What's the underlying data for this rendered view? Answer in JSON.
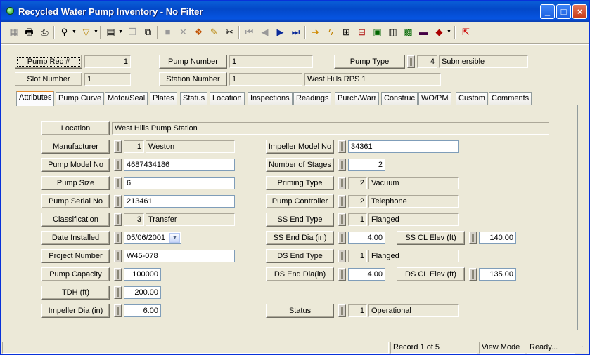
{
  "window": {
    "title": "Recycled Water Pump Inventory - No Filter",
    "minimize_label": "_",
    "maximize_label": "□",
    "close_label": "×"
  },
  "toolbar": {
    "icons": [
      "grid-icon",
      "print-icon",
      "print-preview-icon",
      "binoculars-icon",
      "filter-icon",
      "new-record-icon",
      "copy-icon",
      "paste-icon",
      "save-icon",
      "delete-icon",
      "stack-icon",
      "pencil-icon",
      "scissors-icon",
      "first-record-icon",
      "previous-record-icon",
      "next-record-icon",
      "last-record-icon",
      "jump-icon",
      "lightning-icon",
      "link-icon",
      "tree-icon",
      "map-icon",
      "calculator-icon",
      "chart-icon",
      "books-icon",
      "exit-icon"
    ]
  },
  "header": {
    "pump_rec_label": "Pump Rec #",
    "pump_rec_value": "1",
    "slot_number_label": "Slot Number",
    "slot_number_value": "1",
    "pump_number_label": "Pump Number",
    "pump_number_value": "1",
    "station_number_label": "Station Number",
    "station_number_value": "1",
    "station_name": "West Hills RPS 1",
    "pump_type_label": "Pump Type",
    "pump_type_code": "4",
    "pump_type_value": "Submersible"
  },
  "tabs": [
    "Attributes",
    "Pump Curve",
    "Motor/Seal",
    "Plates",
    "Status",
    "Location",
    "Inspections",
    "Readings",
    "Purch/Warr",
    "Construc",
    "WO/PM",
    "Custom",
    "Comments"
  ],
  "attributes": {
    "location_label": "Location",
    "location_value": "West Hills Pump Station",
    "manufacturer_label": "Manufacturer",
    "manufacturer_code": "1",
    "manufacturer_value": "Weston",
    "pump_model_label": "Pump Model No",
    "pump_model_value": "4687434186",
    "pump_size_label": "Pump Size",
    "pump_size_value": "6",
    "pump_serial_label": "Pump Serial No",
    "pump_serial_value": "213461",
    "classification_label": "Classification",
    "classification_code": "3",
    "classification_value": "Transfer",
    "date_installed_label": "Date Installed",
    "date_installed_value": "05/06/2001",
    "project_number_label": "Project Number",
    "project_number_value": "W45-078",
    "pump_capacity_label": "Pump Capacity",
    "pump_capacity_value": "100000",
    "tdh_label": "TDH (ft)",
    "tdh_value": "200.00",
    "impeller_dia_label": "Impeller Dia (in)",
    "impeller_dia_value": "6.00",
    "impeller_model_label": "Impeller Model No",
    "impeller_model_value": "34361",
    "stages_label": "Number of Stages",
    "stages_value": "2",
    "priming_type_label": "Priming Type",
    "priming_type_code": "2",
    "priming_type_value": "Vacuum",
    "pump_controller_label": "Pump Controller",
    "pump_controller_code": "2",
    "pump_controller_value": "Telephone",
    "ss_end_type_label": "SS End Type",
    "ss_end_type_code": "1",
    "ss_end_type_value": "Flanged",
    "ss_end_dia_label": "SS End Dia (in)",
    "ss_end_dia_value": "4.00",
    "ss_cl_elev_label": "SS CL Elev (ft)",
    "ss_cl_elev_value": "140.00",
    "ds_end_type_label": "DS End Type",
    "ds_end_type_code": "1",
    "ds_end_type_value": "Flanged",
    "ds_end_dia_label": "DS End Dia(in)",
    "ds_end_dia_value": "4.00",
    "ds_cl_elev_label": "DS CL Elev (ft)",
    "ds_cl_elev_value": "135.00",
    "status_label": "Status",
    "status_code": "1",
    "status_value": "Operational"
  },
  "statusbar": {
    "record": "Record 1 of 5",
    "mode": "View Mode",
    "state": "Ready..."
  }
}
